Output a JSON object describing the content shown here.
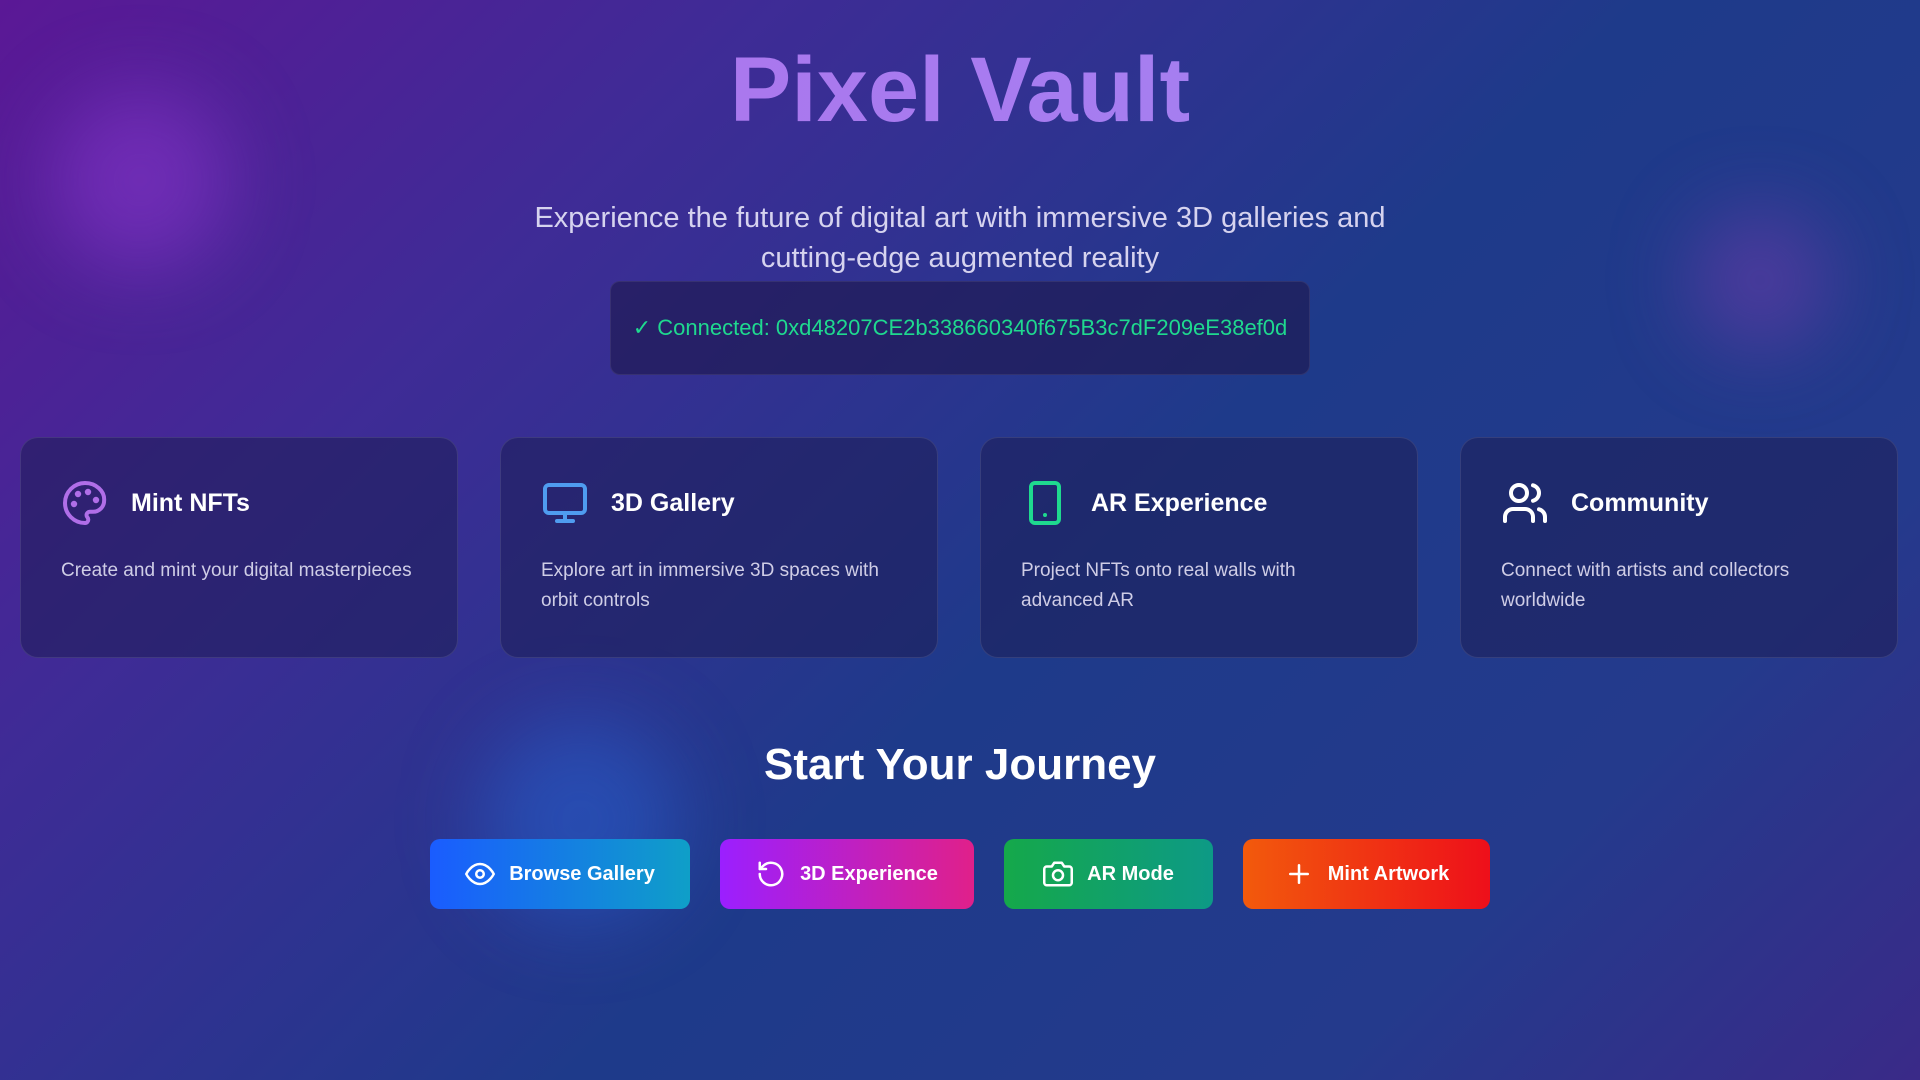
{
  "hero": {
    "title": "Pixel Vault",
    "subtitle_line1": "Experience the future of digital art with immersive 3D galleries and",
    "subtitle_line2": "cutting-edge augmented reality"
  },
  "wallet": {
    "status_text": "✓ Connected: 0xd48207CE2b338660340f675B3c7dF209eE38ef0d"
  },
  "features": [
    {
      "icon": "palette-icon",
      "color": "#b06ee8",
      "title": "Mint NFTs",
      "description": "Create and mint your digital masterpieces"
    },
    {
      "icon": "monitor-icon",
      "color": "#4f9cf0",
      "title": "3D Gallery",
      "description": "Explore art in immersive 3D spaces with orbit controls"
    },
    {
      "icon": "smartphone-icon",
      "color": "#1fd98f",
      "title": "AR Experience",
      "description": "Project NFTs onto real walls with advanced AR"
    },
    {
      "icon": "users-icon",
      "color": "#ffffff",
      "title": "Community",
      "description": "Connect with artists and collectors worldwide"
    }
  ],
  "journey": {
    "heading": "Start Your Journey"
  },
  "actions": {
    "browse_label": "Browse Gallery",
    "experience_label": "3D Experience",
    "ar_label": "AR Mode",
    "mint_label": "Mint Artwork"
  },
  "colors": {
    "accent_purple": "#b06ee8",
    "connected_green": "#1fd98f"
  }
}
